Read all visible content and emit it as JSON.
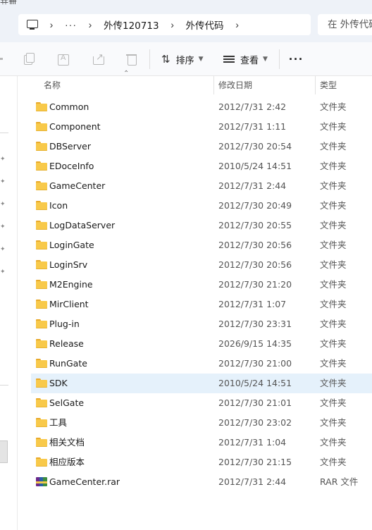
{
  "window": {
    "title_fragment": "共卌"
  },
  "address_bar": {
    "icon": "this-pc-icon",
    "ellipsis": "···",
    "crumbs": [
      "外传120713",
      "外传代码"
    ]
  },
  "search": {
    "placeholder": "在 外传代码 中搜索"
  },
  "toolbar": {
    "sort_label": "排序",
    "view_label": "查看",
    "more_label": "···",
    "icons": [
      "copy-icon",
      "rename-icon",
      "share-icon",
      "delete-icon",
      "sort-icon",
      "view-icon"
    ]
  },
  "columns": {
    "name": "名称",
    "modified": "修改日期",
    "type": "类型"
  },
  "files": [
    {
      "name": "Common",
      "modified": "2012/7/31 2:42",
      "type": "文件夹",
      "icon": "folder-icon"
    },
    {
      "name": "Component",
      "modified": "2012/7/31 1:11",
      "type": "文件夹",
      "icon": "folder-icon"
    },
    {
      "name": "DBServer",
      "modified": "2012/7/30 20:54",
      "type": "文件夹",
      "icon": "folder-icon"
    },
    {
      "name": "EDoceInfo",
      "modified": "2010/5/24 14:51",
      "type": "文件夹",
      "icon": "folder-icon"
    },
    {
      "name": "GameCenter",
      "modified": "2012/7/31 2:44",
      "type": "文件夹",
      "icon": "folder-icon"
    },
    {
      "name": "Icon",
      "modified": "2012/7/30 20:49",
      "type": "文件夹",
      "icon": "folder-icon"
    },
    {
      "name": "LogDataServer",
      "modified": "2012/7/30 20:55",
      "type": "文件夹",
      "icon": "folder-icon"
    },
    {
      "name": "LoginGate",
      "modified": "2012/7/30 20:56",
      "type": "文件夹",
      "icon": "folder-icon"
    },
    {
      "name": "LoginSrv",
      "modified": "2012/7/30 20:56",
      "type": "文件夹",
      "icon": "folder-icon"
    },
    {
      "name": "M2Engine",
      "modified": "2012/7/30 21:20",
      "type": "文件夹",
      "icon": "folder-icon"
    },
    {
      "name": "MirClient",
      "modified": "2012/7/31 1:07",
      "type": "文件夹",
      "icon": "folder-icon"
    },
    {
      "name": "Plug-in",
      "modified": "2012/7/30 23:31",
      "type": "文件夹",
      "icon": "folder-icon"
    },
    {
      "name": "Release",
      "modified": "2026/9/15 14:35",
      "type": "文件夹",
      "icon": "folder-icon"
    },
    {
      "name": "RunGate",
      "modified": "2012/7/30 21:00",
      "type": "文件夹",
      "icon": "folder-icon"
    },
    {
      "name": "SDK",
      "modified": "2010/5/24 14:51",
      "type": "文件夹",
      "icon": "folder-icon",
      "selected": true
    },
    {
      "name": "SelGate",
      "modified": "2012/7/30 21:01",
      "type": "文件夹",
      "icon": "folder-icon"
    },
    {
      "name": "工具",
      "modified": "2012/7/30 23:02",
      "type": "文件夹",
      "icon": "folder-icon"
    },
    {
      "name": "相关文档",
      "modified": "2012/7/31 1:04",
      "type": "文件夹",
      "icon": "folder-icon"
    },
    {
      "name": "相应版本",
      "modified": "2012/7/30 21:15",
      "type": "文件夹",
      "icon": "folder-icon"
    },
    {
      "name": "GameCenter.rar",
      "modified": "2012/7/31 2:44",
      "type": "RAR 文件",
      "icon": "rar-archive-icon"
    }
  ],
  "colors": {
    "selection": "#e5f1fb",
    "folder": "#f8c94a",
    "chrome_bg": "#eef2f8"
  }
}
